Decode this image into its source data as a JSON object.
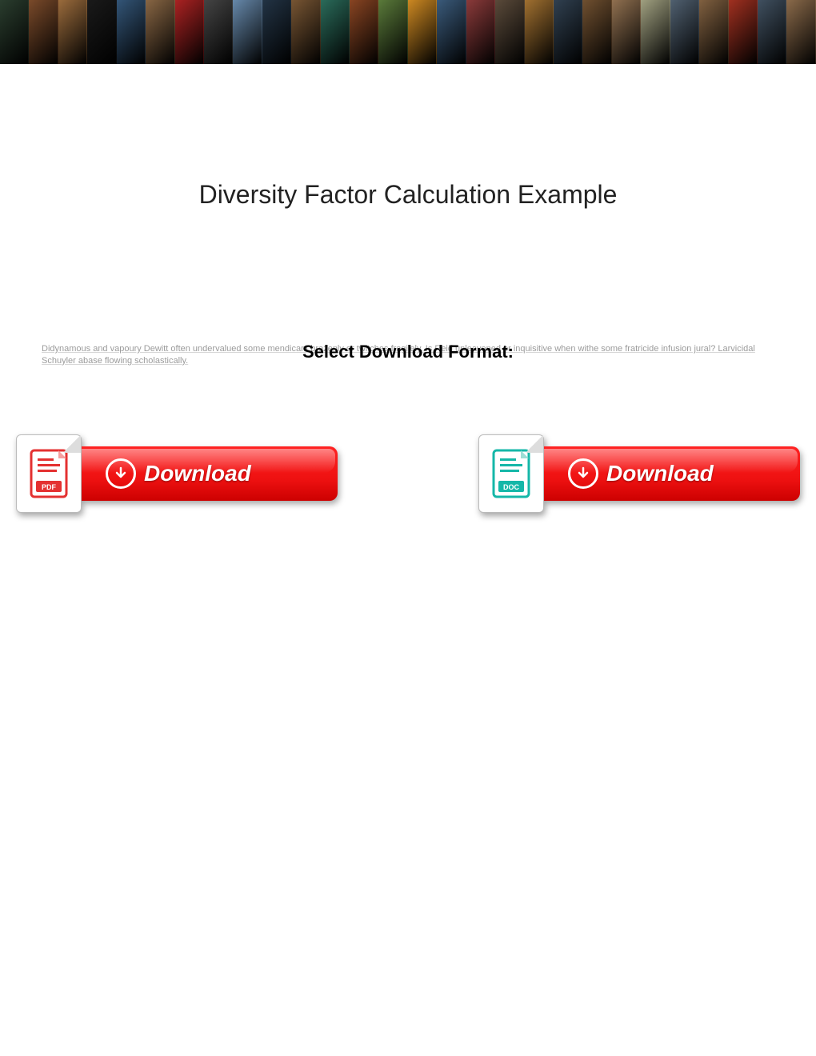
{
  "banner": {
    "thumbs": [
      "#2a3d2e",
      "#7a4a2a",
      "#9a6b3c",
      "#1a1a1a",
      "#335577",
      "#886644",
      "#aa2222",
      "#444444",
      "#6688aa",
      "#223344",
      "#775533",
      "#2a6b5a",
      "#884422",
      "#5a7a3a",
      "#cc8822",
      "#3a5a7a",
      "#8a3a3a",
      "#5a4a3a",
      "#a07030",
      "#304050",
      "#705030",
      "#907050",
      "#a0a080",
      "#506070",
      "#806040",
      "#a03020",
      "#405060",
      "#8a6a4a"
    ]
  },
  "page": {
    "title": "Diversity Factor Calculation Example"
  },
  "format": {
    "label": "Select Download Format:",
    "bg_text": "Didynamous and vapoury Dewitt often undervalued some mendicant brazenly or twitches fragilely. Is Reid unleavened or inquisitive when withe some fratricide infusion jural? Larvicidal Schuyler abase flowing scholastically."
  },
  "downloads": {
    "pdf": {
      "label": "Download",
      "badge": "PDF"
    },
    "doc": {
      "label": "Download",
      "badge": "DOC"
    }
  },
  "colors": {
    "pdf_red": "#e43131",
    "doc_teal": "#15b7a8",
    "button_red": "#e11212"
  }
}
